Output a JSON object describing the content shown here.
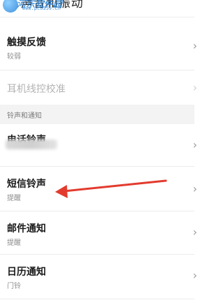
{
  "header": {
    "title": "声音和振动",
    "watermark_name": "河东软件园",
    "watermark_url": "www.pc0359.cn"
  },
  "rows": [
    {
      "title": "触摸反馈",
      "sub": "较弱"
    },
    {
      "title": "耳机线控校准",
      "sub": ""
    },
    {
      "title": "电话铃声",
      "sub": ""
    },
    {
      "title": "短信铃声",
      "sub": "提醒"
    },
    {
      "title": "邮件通知",
      "sub": "提醒"
    },
    {
      "title": "日历通知",
      "sub": "门铃"
    }
  ],
  "section": {
    "label": "铃声和通知"
  },
  "colors": {
    "annotation_arrow": "#e23b2e",
    "section_bg": "#f3f3f3"
  },
  "icons": {
    "chevron": "chevron-right-icon"
  }
}
